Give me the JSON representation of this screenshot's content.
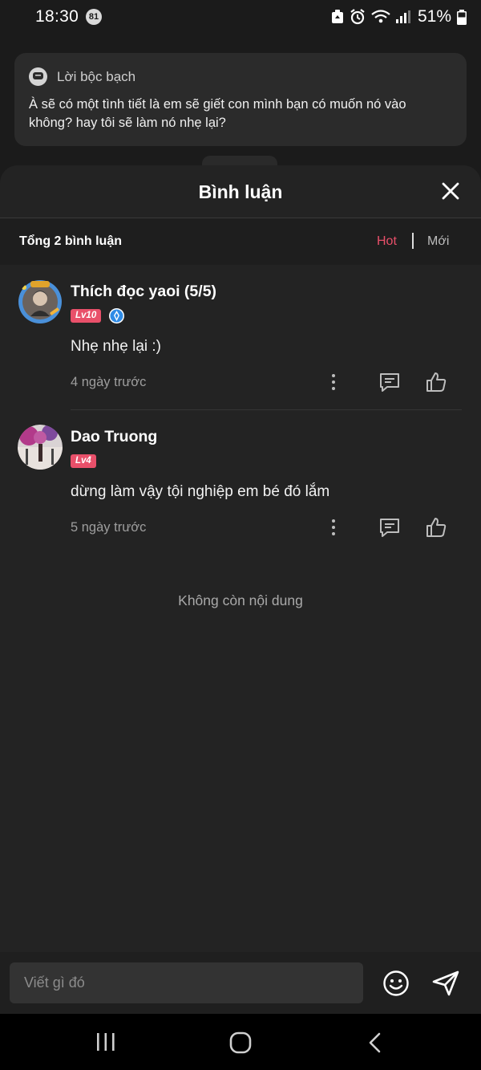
{
  "status_bar": {
    "time": "18:30",
    "notification_count": "81",
    "battery": "51%"
  },
  "dialog": {
    "title": "Lời bộc bạch",
    "text": "À sẽ có một tình tiết là em sẽ giết con mình bạn có muốn nó vào không? hay tôi sẽ làm nó nhẹ lại?"
  },
  "sheet": {
    "title": "Bình luận",
    "total": "Tổng 2 bình luận",
    "sort_hot": "Hot",
    "sort_new": "Mới",
    "end_text": "Không còn nội dung"
  },
  "comments": [
    {
      "user": "Thích đọc yaoi (5/5)",
      "level": "Lv10",
      "text": "Nhẹ nhẹ lại :)",
      "time": "4 ngày trước"
    },
    {
      "user": "Dao Truong",
      "level": "Lv4",
      "text": "dừng làm vậy tội nghiệp em bé đó lắm",
      "time": "5 ngày trước"
    }
  ],
  "input": {
    "placeholder": "Viết gì đó"
  },
  "colors": {
    "accent": "#e9506a",
    "background": "#232323",
    "card": "#2b2b2b"
  }
}
